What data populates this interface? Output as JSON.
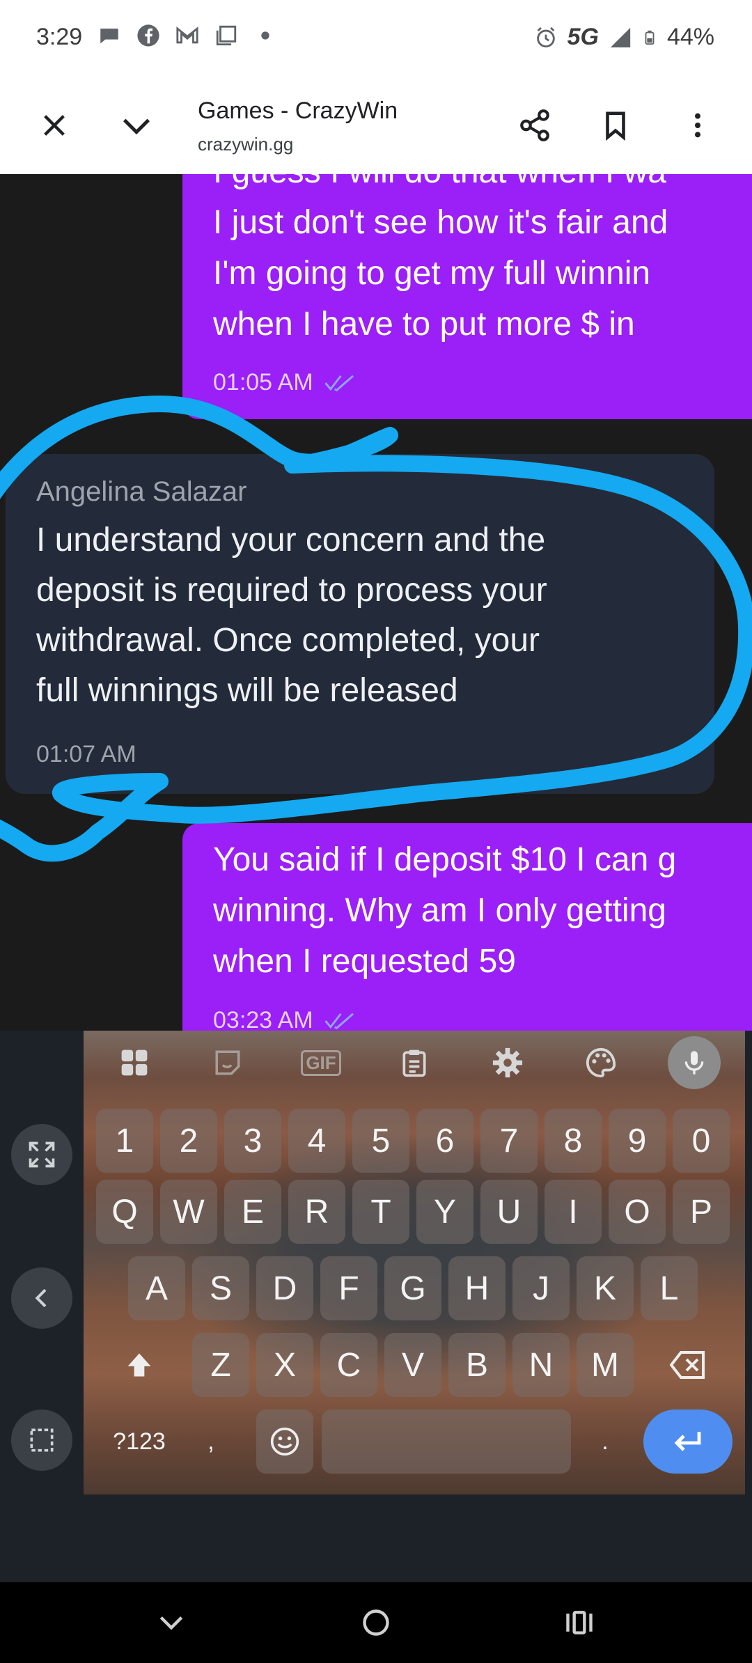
{
  "status_bar": {
    "time": "3:29",
    "network": "5G",
    "battery": "44%",
    "notification_icons": [
      "chat-icon",
      "facebook-icon",
      "gmail-icon",
      "screenshot-icon",
      "dot-icon"
    ]
  },
  "browser": {
    "title": "Games - CrazyWin",
    "url": "crazywin.gg"
  },
  "chat": {
    "messages": [
      {
        "direction": "outgoing",
        "text": "I guess I will do that when I wa\nI just don't see how it's fair and\nI'm going to get my full winnin\nwhen I have to put more $ in",
        "time": "01:05 AM",
        "read": true
      },
      {
        "direction": "incoming",
        "sender": "Angelina Salazar",
        "text": "I understand your concern and the\ndeposit is required to process your\nwithdrawal. Once completed, your\nfull winnings will be released",
        "time": "01:07 AM"
      },
      {
        "direction": "outgoing",
        "text": "You said if I deposit $10 I can g\nwinning. Why am I only getting\nwhen I requested 59",
        "time": "03:23 AM",
        "read": true
      }
    ]
  },
  "keyboard": {
    "toolbar": [
      "apps-icon",
      "sticker-icon",
      "gif-icon",
      "clipboard-icon",
      "settings-icon",
      "theme-icon",
      "mic-icon"
    ],
    "gif_label": "GIF",
    "number_row": [
      "1",
      "2",
      "3",
      "4",
      "5",
      "6",
      "7",
      "8",
      "9",
      "0"
    ],
    "row1": [
      "Q",
      "W",
      "E",
      "R",
      "T",
      "Y",
      "U",
      "I",
      "O",
      "P"
    ],
    "row2": [
      "A",
      "S",
      "D",
      "F",
      "G",
      "H",
      "J",
      "K",
      "L"
    ],
    "row3": [
      "Z",
      "X",
      "C",
      "V",
      "B",
      "N",
      "M"
    ],
    "symbols_label": "?123",
    "comma": ",",
    "period": "."
  },
  "colors": {
    "outgoing_bubble": "#9b1ff7",
    "incoming_bubble": "#232b3a",
    "annotation": "#14a9f0",
    "enter_key": "#4f8ef0"
  }
}
